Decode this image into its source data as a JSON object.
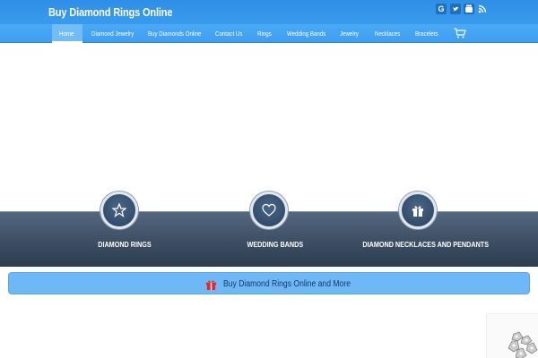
{
  "header": {
    "site_title": "Buy Diamond Rings Online",
    "social_icons": [
      "google-plus-icon",
      "twitter-icon",
      "youtube-icon",
      "rss-icon"
    ]
  },
  "nav": {
    "items": [
      "Home",
      "Diamond Jewelry",
      "Buy Diamonds Online",
      "Contact Us",
      "Rings",
      "Wedding Bands",
      "Jewelry",
      "Necklaces",
      "Bracelets"
    ],
    "active": "Home",
    "cart_icon": "cart-icon"
  },
  "features": [
    {
      "icon": "star-icon",
      "label": "DIAMOND RINGS"
    },
    {
      "icon": "heart-icon",
      "label": "WEDDING BANDS"
    },
    {
      "icon": "gift-icon",
      "label": "DIAMOND NECKLACES AND PENDANTS"
    }
  ],
  "cta": {
    "icon": "gift-icon",
    "label": "Buy Diamond Rings Online and More"
  },
  "colors": {
    "header_blue": "#3a9bee",
    "nav_blue": "#4aaaf6",
    "band_dark": "#3b4c61",
    "cta_blue": "#6fb8f7",
    "gift_red": "#e0282e"
  }
}
